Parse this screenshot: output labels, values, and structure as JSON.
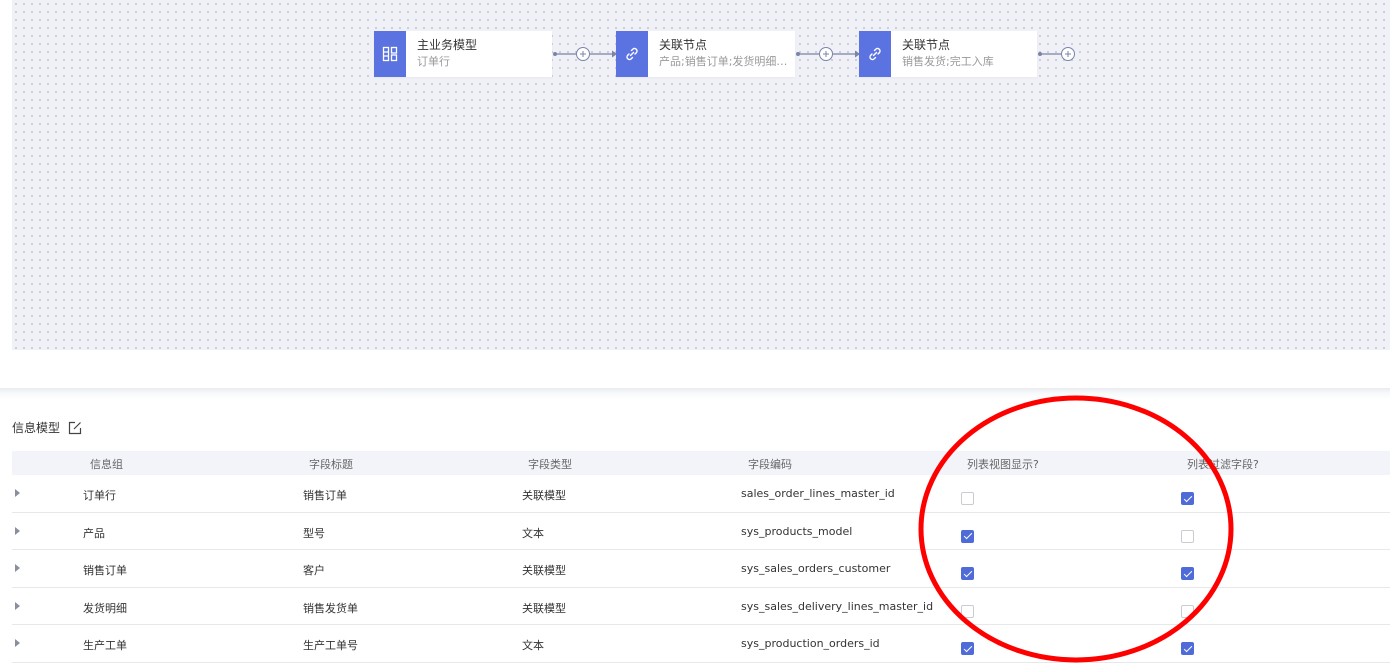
{
  "flow": {
    "nodes": [
      {
        "title": "主业务模型",
        "subtitle": "订单行",
        "icon": "grid-layout-icon"
      },
      {
        "title": "关联节点",
        "subtitle": "产品;销售订单;发货明细…",
        "icon": "link-icon"
      },
      {
        "title": "关联节点",
        "subtitle": "销售发货;完工入库",
        "icon": "link-icon"
      }
    ]
  },
  "info": {
    "title": "信息模型",
    "edit_icon": "edit-icon",
    "columns": [
      "信息组",
      "字段标题",
      "字段类型",
      "字段编码",
      "列表视图显示?",
      "列表过滤字段?"
    ],
    "rows": [
      {
        "group": "订单行",
        "title": "销售订单",
        "type": "关联模型",
        "code": "sales_order_lines_master_id",
        "list_view": false,
        "list_filter": true
      },
      {
        "group": "产品",
        "title": "型号",
        "type": "文本",
        "code": "sys_products_model",
        "list_view": true,
        "list_filter": false
      },
      {
        "group": "销售订单",
        "title": "客户",
        "type": "关联模型",
        "code": "sys_sales_orders_customer",
        "list_view": true,
        "list_filter": true
      },
      {
        "group": "发货明细",
        "title": "销售发货单",
        "type": "关联模型",
        "code": "sys_sales_delivery_lines_master_id",
        "list_view": false,
        "list_filter": false
      },
      {
        "group": "生产工单",
        "title": "生产工单号",
        "type": "文本",
        "code": "sys_production_orders_id",
        "list_view": true,
        "list_filter": true
      }
    ]
  },
  "colors": {
    "accent": "#5b73e0",
    "checkbox": "#4f6bd8",
    "annotation": "#ff0000"
  }
}
